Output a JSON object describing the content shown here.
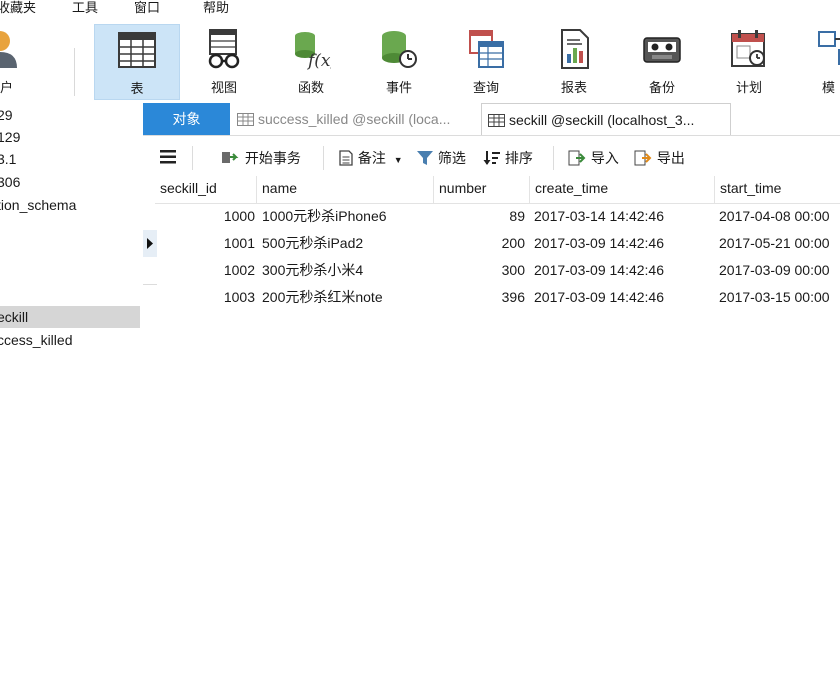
{
  "menu": [
    "收藏夹",
    "工具",
    "窗口",
    "帮助"
  ],
  "toolbar": [
    {
      "label": "用户",
      "icon": "user-icon"
    },
    {
      "label": "表",
      "icon": "table-icon"
    },
    {
      "label": "视图",
      "icon": "view-icon"
    },
    {
      "label": "函数",
      "icon": "function-icon"
    },
    {
      "label": "事件",
      "icon": "event-icon"
    },
    {
      "label": "查询",
      "icon": "query-icon"
    },
    {
      "label": "报表",
      "icon": "report-icon"
    },
    {
      "label": "备份",
      "icon": "backup-icon"
    },
    {
      "label": "计划",
      "icon": "schedule-icon"
    },
    {
      "label": "模",
      "icon": "model-icon"
    }
  ],
  "nav": [
    "29",
    "129",
    "3.1",
    "306",
    "tion_schema",
    "eckill",
    "ccess_killed"
  ],
  "tabs": {
    "objects": "对象",
    "tab1": "success_killed @seckill (loca...",
    "tab2": "seckill @seckill (localhost_3..."
  },
  "datatoolbar": {
    "begin_tx": "开始事务",
    "note": "备注",
    "filter": "筛选",
    "sort": "排序",
    "import": "导入",
    "export": "导出"
  },
  "columns": [
    "seckill_id",
    "name",
    "number",
    "create_time",
    "start_time"
  ],
  "rows": [
    [
      "1000",
      "1000元秒杀iPhone6",
      "89",
      "2017-03-14 14:42:46",
      "2017-04-08 00:00"
    ],
    [
      "1001",
      "500元秒杀iPad2",
      "200",
      "2017-03-09 14:42:46",
      "2017-05-21 00:00"
    ],
    [
      "1002",
      "300元秒杀小米4",
      "300",
      "2017-03-09 14:42:46",
      "2017-03-09 00:00"
    ],
    [
      "1003",
      "200元秒杀红米note",
      "396",
      "2017-03-09 14:42:46",
      "2017-03-15 00:00"
    ]
  ],
  "colors": {
    "accent": "#2b88d8",
    "active_button": "#cce4f7",
    "selected_nav": "#d6d6d6"
  }
}
